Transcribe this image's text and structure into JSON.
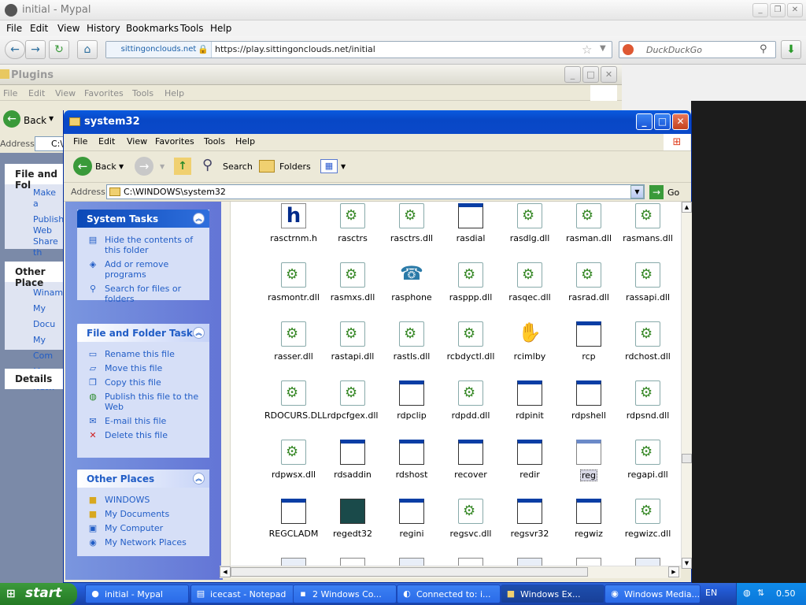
{
  "firefox": {
    "title": "initial - Mypal",
    "menu": [
      "File",
      "Edit",
      "View",
      "History",
      "Bookmarks",
      "Tools",
      "Help"
    ],
    "site_identity": "sittingonclouds.net",
    "url": "https://play.sittingonclouds.net/initial",
    "search_placeholder": "DuckDuckGo"
  },
  "plugins_window": {
    "title": "Plugins",
    "menu": [
      "File",
      "Edit",
      "View",
      "Favorites",
      "Tools",
      "Help"
    ],
    "back_label": "Back",
    "address_label": "Address",
    "address_value": "C:\\",
    "pane": {
      "file_tasks_header": "File and Fol",
      "items": [
        "Make a",
        "Publish",
        "Web",
        "Share th"
      ],
      "other_places_header": "Other Place",
      "places": [
        "Winamp",
        "My Docu",
        "My Com",
        "My Netw"
      ],
      "details_header": "Details"
    }
  },
  "window": {
    "title": "system32",
    "menu": [
      "File",
      "Edit",
      "View",
      "Favorites",
      "Tools",
      "Help"
    ],
    "toolbar": {
      "back": "Back",
      "search": "Search",
      "folders": "Folders"
    },
    "address_label": "Address",
    "address_value": "C:\\WINDOWS\\system32",
    "go_label": "Go"
  },
  "tasks": {
    "system": {
      "header": "System Tasks",
      "items": [
        "Hide the contents of this folder",
        "Add or remove programs",
        "Search for files or folders"
      ]
    },
    "file_folder": {
      "header": "File and Folder Tasks",
      "items": [
        "Rename this file",
        "Move this file",
        "Copy this file",
        "Publish this file to the Web",
        "E-mail this file",
        "Delete this file"
      ]
    },
    "other_places": {
      "header": "Other Places",
      "items": [
        "WINDOWS",
        "My Documents",
        "My Computer",
        "My Network Places"
      ]
    }
  },
  "files": [
    {
      "name": "rasctrnm.h",
      "type": "h"
    },
    {
      "name": "rasctrs",
      "type": "cfg"
    },
    {
      "name": "rasctrs.dll",
      "type": "dll"
    },
    {
      "name": "rasdial",
      "type": "exe"
    },
    {
      "name": "rasdlg.dll",
      "type": "dll"
    },
    {
      "name": "rasman.dll",
      "type": "dll"
    },
    {
      "name": "rasmans.dll",
      "type": "dll"
    },
    {
      "name": "rasmontr.dll",
      "type": "dll"
    },
    {
      "name": "rasmxs.dll",
      "type": "dll"
    },
    {
      "name": "rasphone",
      "type": "net"
    },
    {
      "name": "rasppp.dll",
      "type": "dll"
    },
    {
      "name": "rasqec.dll",
      "type": "dll"
    },
    {
      "name": "rasrad.dll",
      "type": "dll"
    },
    {
      "name": "rassapi.dll",
      "type": "dll"
    },
    {
      "name": "rasser.dll",
      "type": "dll"
    },
    {
      "name": "rastapi.dll",
      "type": "dll"
    },
    {
      "name": "rastls.dll",
      "type": "dll"
    },
    {
      "name": "rcbdyctl.dll",
      "type": "dll"
    },
    {
      "name": "rcimlby",
      "type": "hand"
    },
    {
      "name": "rcp",
      "type": "exe"
    },
    {
      "name": "rdchost.dll",
      "type": "dll"
    },
    {
      "name": "RDOCURS.DLL",
      "type": "dll"
    },
    {
      "name": "rdpcfgex.dll",
      "type": "dll"
    },
    {
      "name": "rdpclip",
      "type": "exe"
    },
    {
      "name": "rdpdd.dll",
      "type": "dll"
    },
    {
      "name": "rdpinit",
      "type": "exe"
    },
    {
      "name": "rdpshell",
      "type": "exe"
    },
    {
      "name": "rdpsnd.dll",
      "type": "dll"
    },
    {
      "name": "rdpwsx.dll",
      "type": "dll"
    },
    {
      "name": "rdsaddin",
      "type": "exe"
    },
    {
      "name": "rdshost",
      "type": "exe"
    },
    {
      "name": "recover",
      "type": "exe"
    },
    {
      "name": "redir",
      "type": "exe"
    },
    {
      "name": "reg",
      "type": "exe",
      "selected": true
    },
    {
      "name": "regapi.dll",
      "type": "dll"
    },
    {
      "name": "REGCLADM",
      "type": "exe"
    },
    {
      "name": "regedt32",
      "type": "regedit"
    },
    {
      "name": "regini",
      "type": "exe"
    },
    {
      "name": "regsvc.dll",
      "type": "dll"
    },
    {
      "name": "regsvr32",
      "type": "exe"
    },
    {
      "name": "regwiz",
      "type": "exe"
    },
    {
      "name": "regwizc.dll",
      "type": "dll"
    }
  ],
  "taskbar": {
    "start": "start",
    "tasks": [
      "initial - Mypal",
      "icecast - Notepad",
      "2 Windows Co...",
      "Connected to: i...",
      "Windows Ex...",
      "Windows Media..."
    ],
    "lang": "EN",
    "clock": "0.50"
  },
  "colors": {
    "title_blue": "#0a5be0",
    "pane_blue": "#6f86da",
    "link_blue": "#215dc6",
    "taskbar": "#245edb",
    "start_green": "#3c9a3c"
  }
}
